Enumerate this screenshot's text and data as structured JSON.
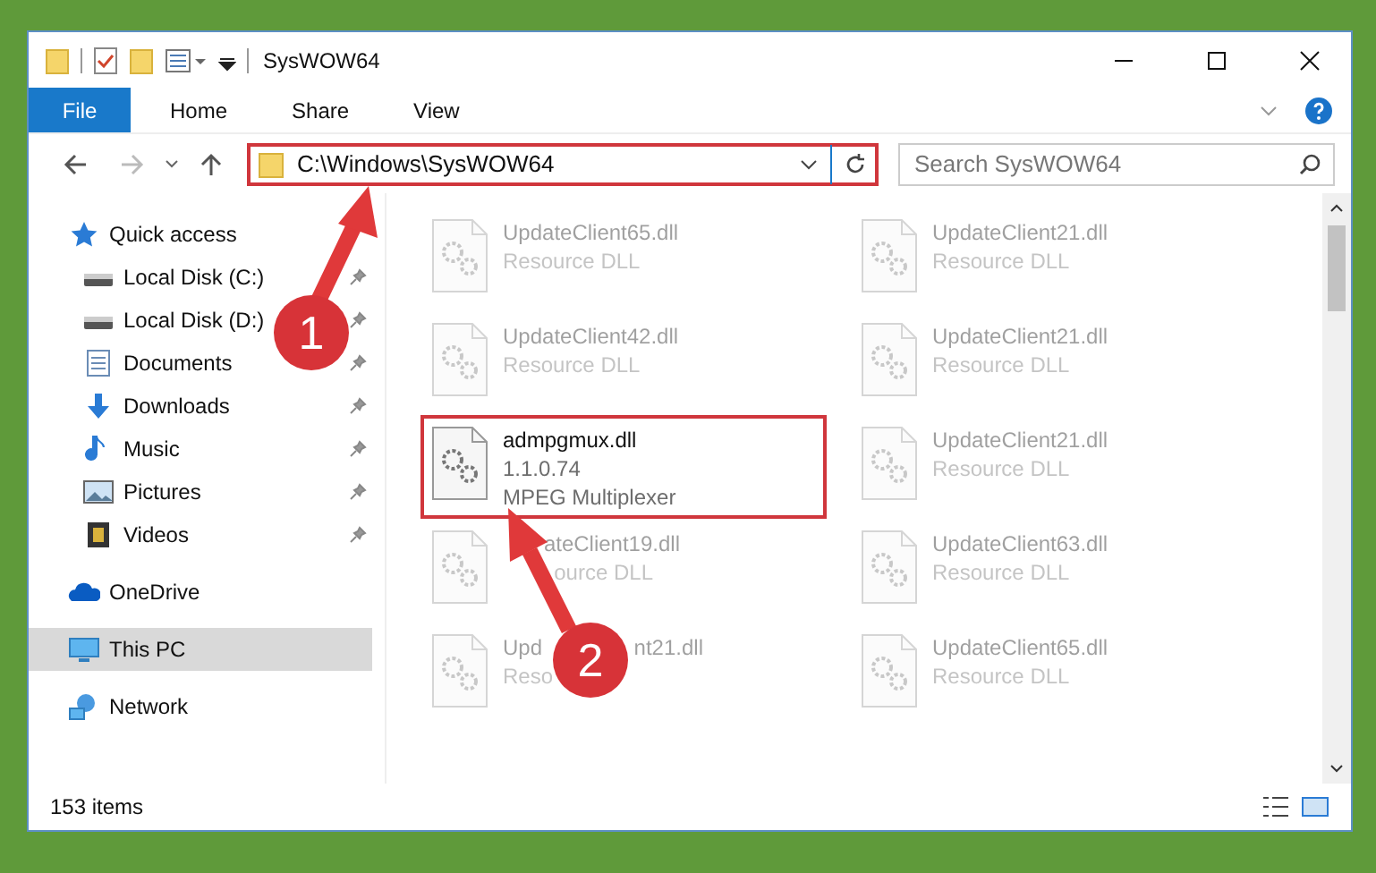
{
  "window": {
    "title": "SysWOW64"
  },
  "ribbon": {
    "tabs": [
      {
        "label": "File",
        "selected": true
      },
      {
        "label": "Home",
        "selected": false
      },
      {
        "label": "Share",
        "selected": false
      },
      {
        "label": "View",
        "selected": false
      }
    ]
  },
  "address": {
    "path": "C:\\Windows\\SysWOW64",
    "highlighted": true
  },
  "search": {
    "placeholder": "Search SysWOW64"
  },
  "sidebar": {
    "items": [
      {
        "label": "Quick access",
        "kind": "star",
        "selected": false,
        "children": [
          {
            "label": "Local Disk (C:)",
            "kind": "drive",
            "pinned": true
          },
          {
            "label": "Local Disk (D:)",
            "kind": "drive",
            "pinned": true
          },
          {
            "label": "Documents",
            "kind": "document",
            "pinned": true
          },
          {
            "label": "Downloads",
            "kind": "download",
            "pinned": true
          },
          {
            "label": "Music",
            "kind": "music",
            "pinned": true
          },
          {
            "label": "Pictures",
            "kind": "picture",
            "pinned": true
          },
          {
            "label": "Videos",
            "kind": "video",
            "pinned": true
          }
        ]
      },
      {
        "label": "OneDrive",
        "kind": "cloud",
        "selected": false
      },
      {
        "label": "This PC",
        "kind": "pc",
        "selected": true
      },
      {
        "label": "Network",
        "kind": "network",
        "selected": false
      }
    ]
  },
  "files": [
    {
      "kind": "plain",
      "name": "UpdateClient65.dll",
      "details": [
        "Resource DLL"
      ],
      "faded": true,
      "highlighted": false
    },
    {
      "kind": "plain",
      "name": "UpdateClient21.dll",
      "details": [
        "Resource DLL"
      ],
      "faded": true,
      "highlighted": false
    },
    {
      "kind": "plain",
      "name": "UpdateClient42.dll",
      "details": [
        "Resource DLL"
      ],
      "faded": true,
      "highlighted": false
    },
    {
      "kind": "plain",
      "name": "UpdateClient21.dll",
      "details": [
        "Resource DLL"
      ],
      "faded": true,
      "highlighted": false
    },
    {
      "kind": "plain",
      "name": "admpgmux.dll",
      "details": [
        "1.1.0.74",
        "MPEG Multiplexer"
      ],
      "faded": false,
      "highlighted": true
    },
    {
      "kind": "plain",
      "name": "UpdateClient21.dll",
      "details": [
        "Resource DLL"
      ],
      "faded": true,
      "highlighted": false
    },
    {
      "kind": "covered-start",
      "name_parts": [
        "ateClient19.dll"
      ],
      "detail_parts": [
        "ource DLL"
      ],
      "faded": true,
      "highlighted": false
    },
    {
      "kind": "plain",
      "name": "UpdateClient63.dll",
      "details": [
        "Resource DLL"
      ],
      "faded": true,
      "highlighted": false
    },
    {
      "kind": "covered-middle",
      "name_parts": [
        "Upd",
        "nt21.dll"
      ],
      "detail_parts": [
        "Reso"
      ],
      "faded": true,
      "highlighted": false
    },
    {
      "kind": "plain",
      "name": "UpdateClient65.dll",
      "details": [
        "Resource DLL"
      ],
      "faded": true,
      "highlighted": false
    }
  ],
  "status_bar": {
    "count": "153 items"
  },
  "annotations": [
    {
      "label": "1"
    },
    {
      "label": "2"
    }
  ]
}
